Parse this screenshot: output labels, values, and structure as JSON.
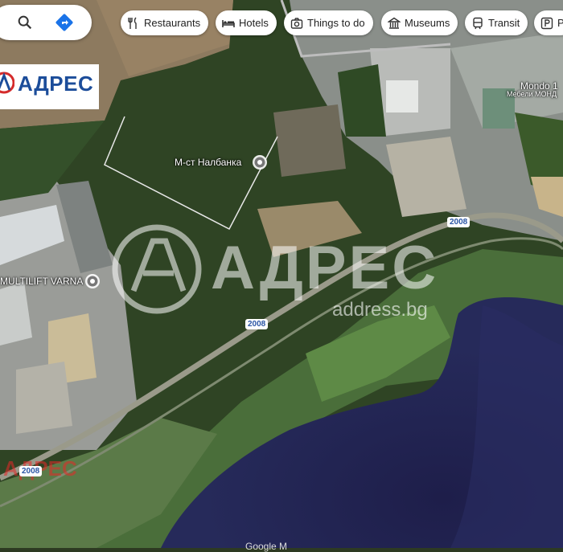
{
  "search": {
    "search_icon": "search-icon",
    "directions_icon": "directions-icon"
  },
  "categories": [
    {
      "label": "Restaurants",
      "icon": "restaurant-icon"
    },
    {
      "label": "Hotels",
      "icon": "hotel-icon"
    },
    {
      "label": "Things to do",
      "icon": "camera-icon"
    },
    {
      "label": "Museums",
      "icon": "museum-icon"
    },
    {
      "label": "Transit",
      "icon": "transit-icon"
    },
    {
      "label": "P",
      "icon": "parking-icon"
    }
  ],
  "watermark": {
    "logo": "АДРЕС",
    "big": "АДРЕС",
    "url": "address.bg",
    "small": "АДРЕС"
  },
  "places": {
    "nalbanka": "М-ст Налбанка",
    "multilift": "MULTILIFT VARNA",
    "mondo": "Mondo 1",
    "mondo_sub": "Мебели МОНД"
  },
  "roads": {
    "route1": "2008",
    "route2": "2008",
    "route3": "2008"
  },
  "footer": "Google M"
}
